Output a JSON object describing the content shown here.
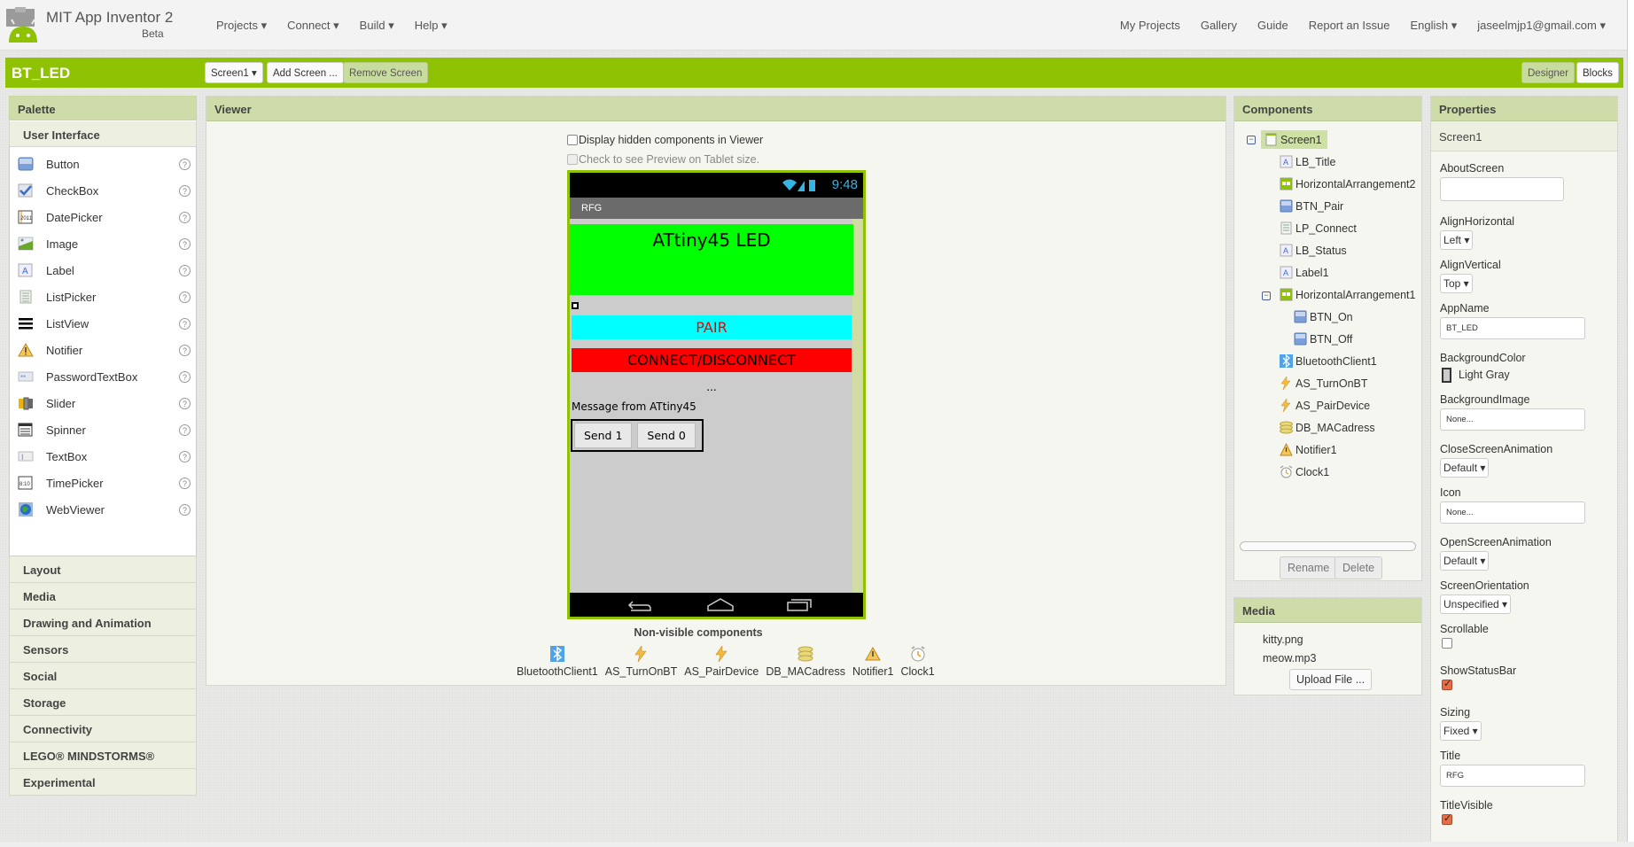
{
  "header": {
    "app_title": "MIT App Inventor 2",
    "app_subtitle": "Beta",
    "nav_left": [
      "Projects ▾",
      "Connect ▾",
      "Build ▾",
      "Help ▾"
    ],
    "nav_right": [
      "My Projects",
      "Gallery",
      "Guide",
      "Report an Issue",
      "English ▾",
      "jaseelmjp1@gmail.com ▾"
    ]
  },
  "project_bar": {
    "project_name": "BT_LED",
    "screen_select": "Screen1 ▾",
    "add_screen": "Add Screen ...",
    "remove_screen": "Remove Screen",
    "designer": "Designer",
    "blocks": "Blocks",
    "accent_color": "#8fc202"
  },
  "palette": {
    "title": "Palette",
    "open_category": "User Interface",
    "items": [
      {
        "label": "Button",
        "icon": "button-icon"
      },
      {
        "label": "CheckBox",
        "icon": "checkbox-icon"
      },
      {
        "label": "DatePicker",
        "icon": "datepicker-icon"
      },
      {
        "label": "Image",
        "icon": "image-icon"
      },
      {
        "label": "Label",
        "icon": "label-icon"
      },
      {
        "label": "ListPicker",
        "icon": "listpicker-icon"
      },
      {
        "label": "ListView",
        "icon": "listview-icon"
      },
      {
        "label": "Notifier",
        "icon": "notifier-icon"
      },
      {
        "label": "PasswordTextBox",
        "icon": "passwordtextbox-icon"
      },
      {
        "label": "Slider",
        "icon": "slider-icon"
      },
      {
        "label": "Spinner",
        "icon": "spinner-icon"
      },
      {
        "label": "TextBox",
        "icon": "textbox-icon"
      },
      {
        "label": "TimePicker",
        "icon": "timepicker-icon"
      },
      {
        "label": "WebViewer",
        "icon": "webviewer-icon"
      }
    ],
    "help_glyph": "?",
    "categories": [
      "Layout",
      "Media",
      "Drawing and Animation",
      "Sensors",
      "Social",
      "Storage",
      "Connectivity",
      "LEGO® MINDSTORMS®",
      "Experimental"
    ]
  },
  "viewer": {
    "title": "Viewer",
    "display_hidden": "Display hidden components in Viewer",
    "tablet_preview": "Check to see Preview on Tablet size.",
    "phone": {
      "time": "9:48",
      "screen_title": "RFG",
      "lb_title": "ATtiny45 LED",
      "btn_pair": "PAIR",
      "lp_connect": "CONNECT/DISCONNECT",
      "lb_status": "...",
      "label1": "Message from ATtiny45",
      "btn_on": "Send 1",
      "btn_off": "Send 0"
    },
    "nonvisible_title": "Non-visible components",
    "nonvisible": [
      "BluetoothClient1",
      "AS_TurnOnBT",
      "AS_PairDevice",
      "DB_MACadress",
      "Notifier1",
      "Clock1"
    ]
  },
  "components": {
    "title": "Components",
    "tree": [
      {
        "label": "Screen1",
        "icon": "screen-icon",
        "level": 0,
        "selected": true
      },
      {
        "label": "LB_Title",
        "icon": "label-icon",
        "level": 1
      },
      {
        "label": "HorizontalArrangement2",
        "icon": "horizontal-arrangement-icon",
        "level": 1
      },
      {
        "label": "BTN_Pair",
        "icon": "button-icon",
        "level": 1
      },
      {
        "label": "LP_Connect",
        "icon": "listpicker-icon",
        "level": 1
      },
      {
        "label": "LB_Status",
        "icon": "label-icon",
        "level": 1
      },
      {
        "label": "Label1",
        "icon": "label-icon",
        "level": 1
      },
      {
        "label": "HorizontalArrangement1",
        "icon": "horizontal-arrangement-icon",
        "level": 1
      },
      {
        "label": "BTN_On",
        "icon": "button-icon",
        "level": 2
      },
      {
        "label": "BTN_Off",
        "icon": "button-icon",
        "level": 2
      },
      {
        "label": "BluetoothClient1",
        "icon": "bluetooth-icon",
        "level": 1
      },
      {
        "label": "AS_TurnOnBT",
        "icon": "activity-starter-icon",
        "level": 1
      },
      {
        "label": "AS_PairDevice",
        "icon": "activity-starter-icon",
        "level": 1
      },
      {
        "label": "DB_MACadress",
        "icon": "tinydb-icon",
        "level": 1
      },
      {
        "label": "Notifier1",
        "icon": "notifier-icon",
        "level": 1
      },
      {
        "label": "Clock1",
        "icon": "clock-icon",
        "level": 1
      }
    ],
    "rename": "Rename",
    "delete": "Delete"
  },
  "media": {
    "title": "Media",
    "files": [
      "kitty.png",
      "meow.mp3"
    ],
    "upload": "Upload File ..."
  },
  "properties": {
    "title": "Properties",
    "component": "Screen1",
    "about_screen": {
      "label": "AboutScreen",
      "value": ""
    },
    "align_horizontal": {
      "label": "AlignHorizontal",
      "value": "Left ▾"
    },
    "align_vertical": {
      "label": "AlignVertical",
      "value": "Top ▾"
    },
    "app_name": {
      "label": "AppName",
      "value": "BT_LED"
    },
    "background_color": {
      "label": "BackgroundColor",
      "value": "Light Gray",
      "swatch": "#cccccc"
    },
    "background_image": {
      "label": "BackgroundImage",
      "value": "None..."
    },
    "close_screen_animation": {
      "label": "CloseScreenAnimation",
      "value": "Default ▾"
    },
    "icon": {
      "label": "Icon",
      "value": "None..."
    },
    "open_screen_animation": {
      "label": "OpenScreenAnimation",
      "value": "Default ▾"
    },
    "screen_orientation": {
      "label": "ScreenOrientation",
      "value": "Unspecified ▾"
    },
    "scrollable": {
      "label": "Scrollable",
      "checked": false
    },
    "show_status_bar": {
      "label": "ShowStatusBar",
      "checked": true
    },
    "sizing": {
      "label": "Sizing",
      "value": "Fixed ▾"
    },
    "title_prop": {
      "label": "Title",
      "value": "RFG"
    },
    "title_visible": {
      "label": "TitleVisible",
      "checked": true
    }
  }
}
